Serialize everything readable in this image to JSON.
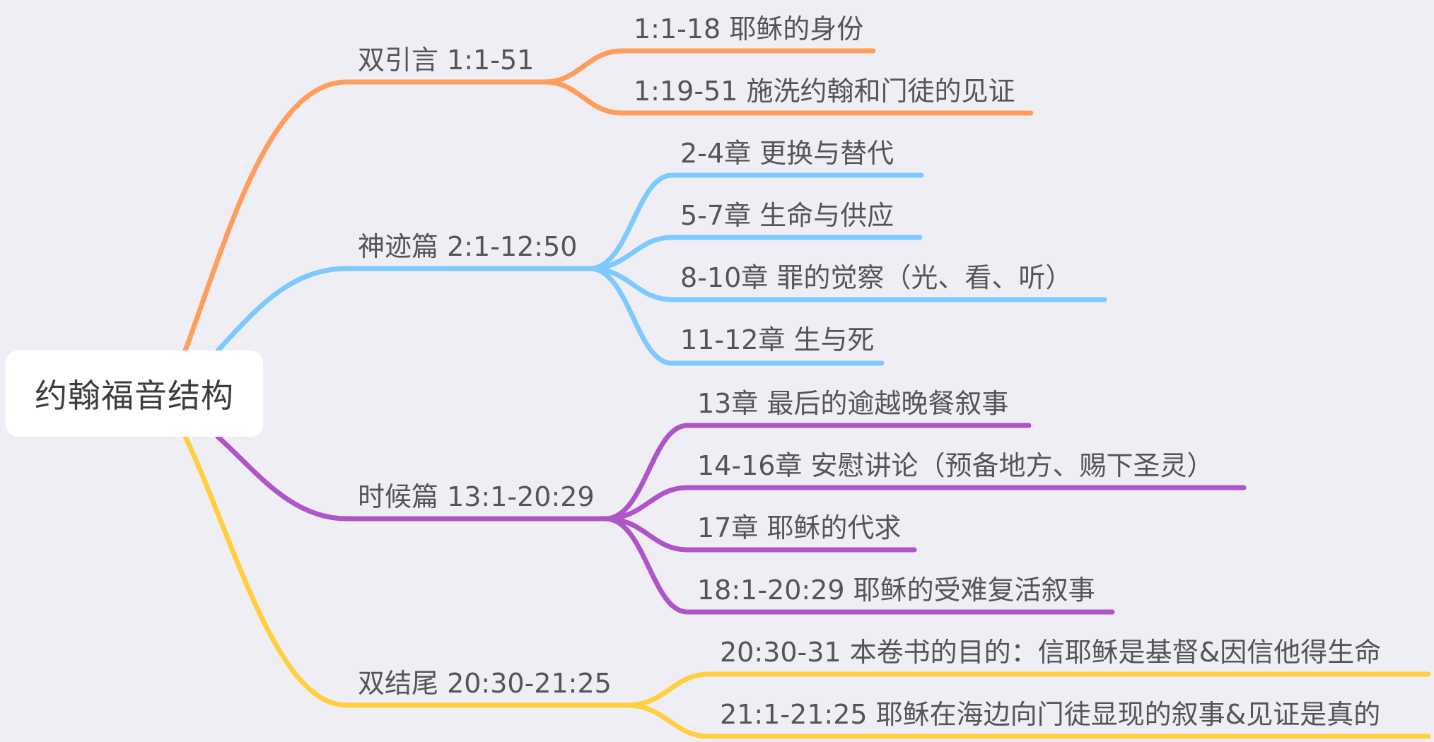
{
  "root": {
    "title": "约翰福音结构"
  },
  "colors": {
    "background": "#efeef4",
    "root_box": "#ffffff",
    "text": "#555555",
    "orange": "#ff9d5c",
    "blue": "#7ccaff",
    "purple": "#ad55c9",
    "yellow": "#ffcf40"
  },
  "branches": [
    {
      "label": "双引言 1:1-51",
      "color": "orange",
      "children": [
        {
          "label": "1:1-18 耶稣的身份"
        },
        {
          "label": "1:19-51 施洗约翰和门徒的见证"
        }
      ]
    },
    {
      "label": "神迹篇 2:1-12:50",
      "color": "blue",
      "children": [
        {
          "label": "2-4章 更换与替代"
        },
        {
          "label": "5-7章 生命与供应"
        },
        {
          "label": "8-10章 罪的觉察（光、看、听）"
        },
        {
          "label": "11-12章 生与死"
        }
      ]
    },
    {
      "label": "时候篇 13:1-20:29",
      "color": "purple",
      "children": [
        {
          "label": "13章 最后的逾越晚餐叙事"
        },
        {
          "label": "14-16章 安慰讲论（预备地方、赐下圣灵）"
        },
        {
          "label": "17章 耶稣的代求"
        },
        {
          "label": "18:1-20:29 耶稣的受难复活叙事"
        }
      ]
    },
    {
      "label": "双结尾 20:30-21:25",
      "color": "yellow",
      "children": [
        {
          "label": "20:30-31 本卷书的目的：信耶稣是基督&因信他得生命"
        },
        {
          "label": "21:1-21:25 耶稣在海边向门徒显现的叙事&见证是真的"
        }
      ]
    }
  ]
}
